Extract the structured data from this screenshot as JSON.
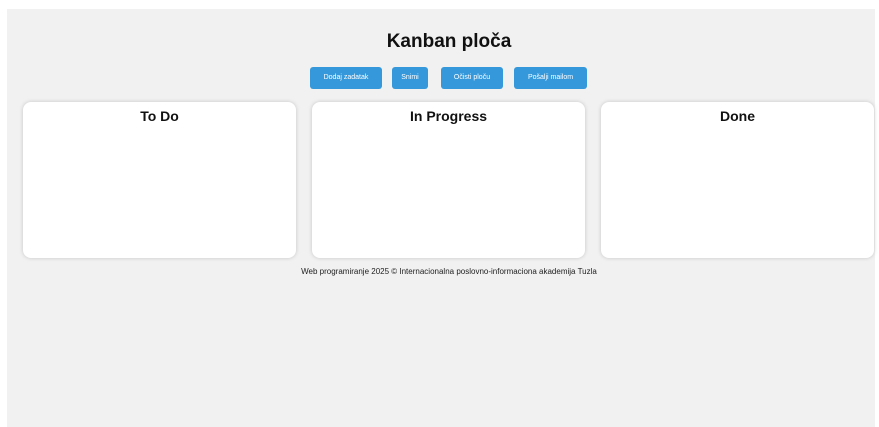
{
  "header": {
    "title": "Kanban ploča"
  },
  "toolbar": {
    "add_task_label": "Dodaj zadatak",
    "save_label": "Snimi",
    "clear_board_label": "Očisti ploču",
    "send_email_label": "Pošalji mailom"
  },
  "columns": [
    {
      "title": "To Do"
    },
    {
      "title": "In Progress"
    },
    {
      "title": "Done"
    }
  ],
  "footer": {
    "text": "Web programiranje 2025 © Internacionalna poslovno-informaciona akademija Tuzla"
  },
  "colors": {
    "button_background": "#3498db",
    "page_background": "#f1f1f1",
    "column_background": "#ffffff"
  }
}
